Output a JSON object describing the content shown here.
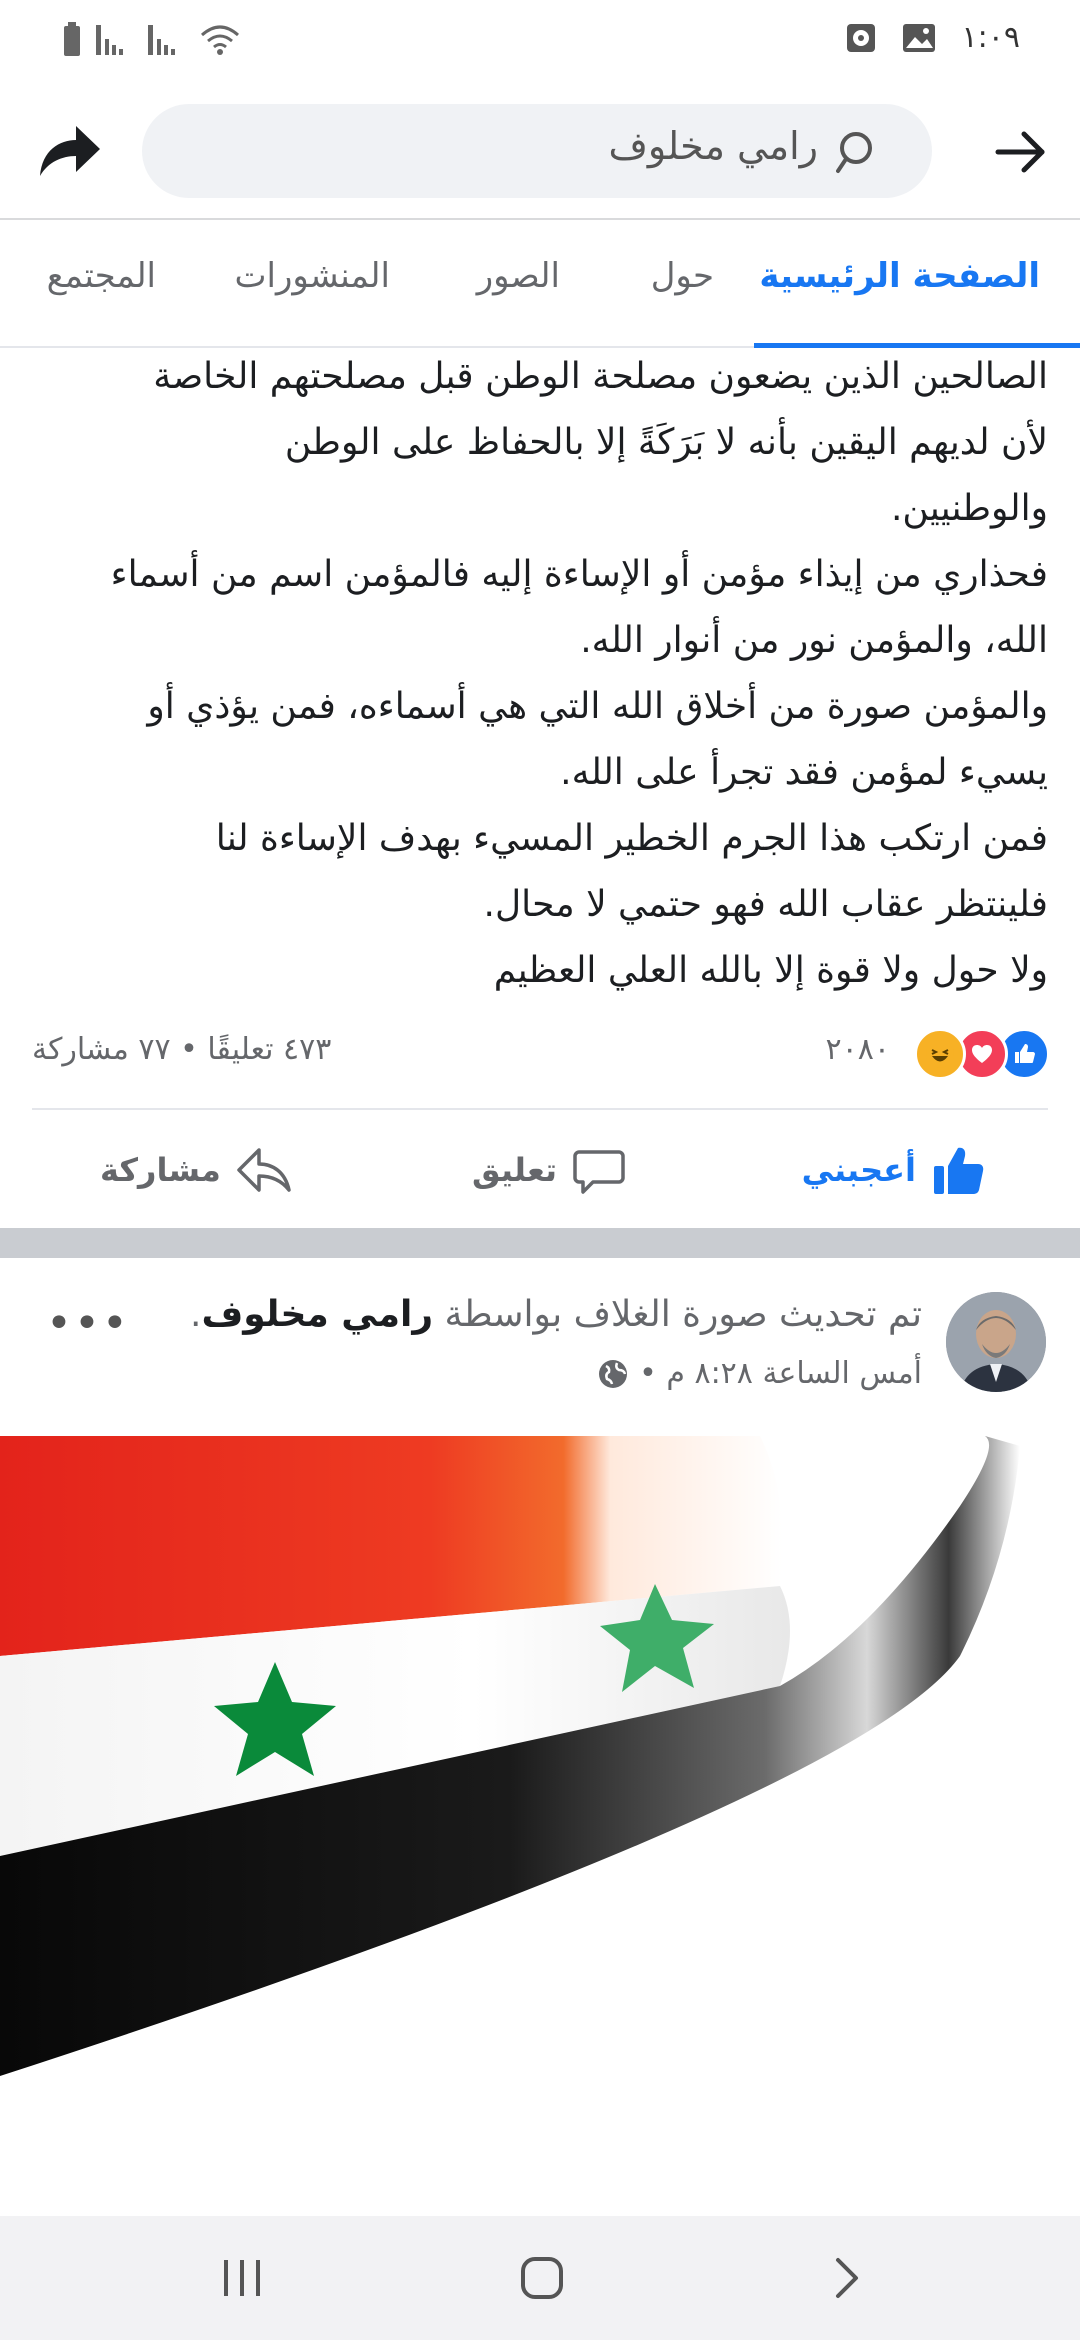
{
  "status_bar": {
    "time": "١:٠٩"
  },
  "header": {
    "search_text": "رامي مخلوف"
  },
  "tabs": [
    {
      "label": "الصفحة الرئيسية",
      "active": true
    },
    {
      "label": "حول"
    },
    {
      "label": "الصور"
    },
    {
      "label": "المنشورات"
    },
    {
      "label": "المجتمع"
    }
  ],
  "post": {
    "lines": [
      "الصالحين الذين يضعون مصلحة الوطن قبل مصلحتهم الخاصة",
      "لأن لديهم اليقين بأنه لا بَرَكَةً إلا بالحفاظ على الوطن",
      "والوطنيين.",
      "فحذاري من إيذاء مؤمن أو الإساءة إليه فالمؤمن اسم من أسماء",
      "الله، والمؤمن نور من أنوار الله.",
      "والمؤمن صورة من أخلاق الله التي هي أسماءه، فمن يؤذي أو",
      "يسيء لمؤمن فقد تجرأ على الله.",
      "فمن ارتكب هذا الجرم الخطير المسيء بهدف الإساءة لنا",
      "فلينتظر عقاب الله فهو حتمي لا محال.",
      "ولا حول ولا قوة إلا بالله العلي العظيم"
    ],
    "reaction_count": "٢٠٨٠",
    "stats": "٤٧٣ تعليقًا • ٧٧ مشاركة",
    "actions": {
      "like": "أعجبني",
      "comment": "تعليق",
      "share": "مشاركة"
    }
  },
  "post2": {
    "title_prefix": "تم تحديث صورة الغلاف بواسطة",
    "author": "رامي مخلوف",
    "title_suffix": ".",
    "meta": "أمس الساعة ٨:٢٨ م •",
    "more": "•••"
  },
  "colors": {
    "accent": "#1877f2",
    "flag_red": "#e8392b",
    "flag_green": "#0a8a3a",
    "flag_black": "#111111"
  }
}
